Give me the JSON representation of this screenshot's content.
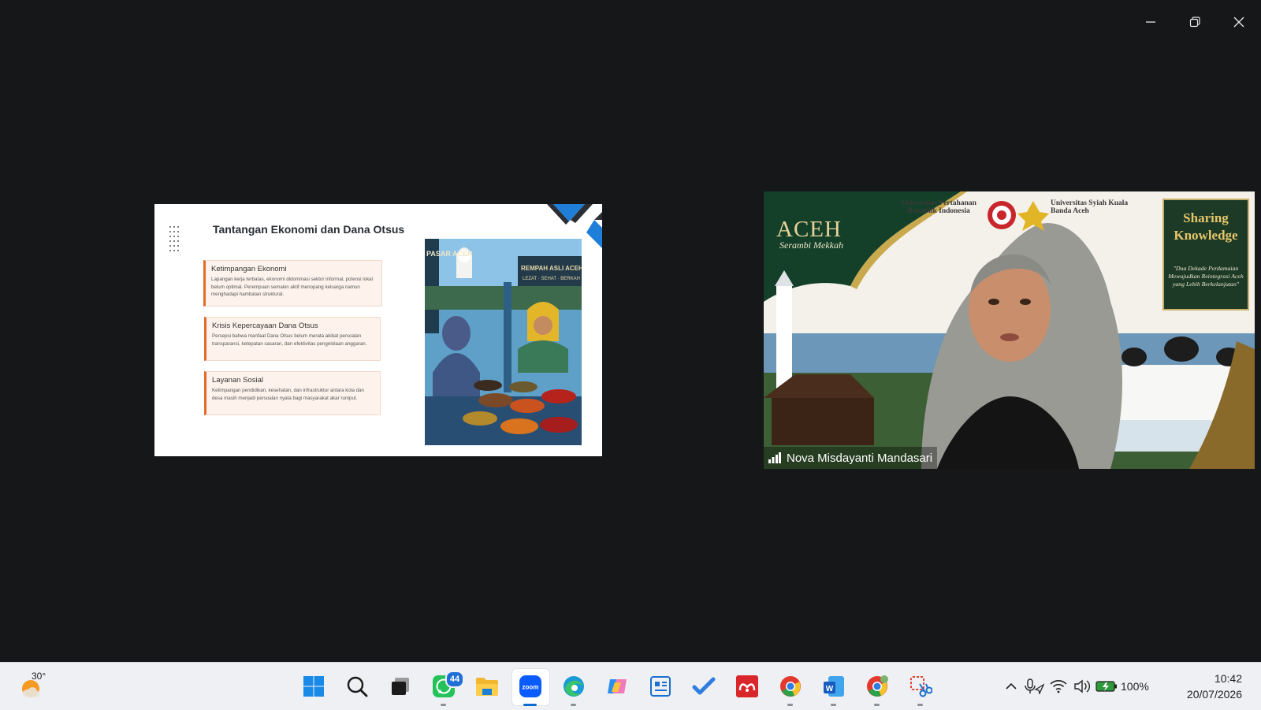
{
  "window": {
    "controls": [
      "minimize-icon",
      "restore-icon",
      "close-icon"
    ]
  },
  "slide": {
    "title": "Tantangan Ekonomi dan Dana Otsus",
    "cards": [
      {
        "title": "Ketimpangan Ekonomi",
        "text": "Lapangan kerja terbatas, ekonomi didominasi sektor informal, potensi lokal belum optimal. Perempuan semakin aktif menopang keluarga namun menghadapi hambatan struktural."
      },
      {
        "title": "Krisis Kepercayaan Dana Otsus",
        "text": "Persepsi bahwa manfaat Dana Otsus belum merata akibat persoalan transparansi, ketepatan sasaran, dan efektivitas pengelolaan anggaran."
      },
      {
        "title": "Layanan Sosial",
        "text": "Ketimpangan pendidikan, kesehatan, dan infrastruktur antara kota dan desa masih menjadi persoalan nyata bagi masyarakat akar rumput."
      }
    ],
    "image_signs": {
      "main": "REMPAH ASLI ACEH",
      "sub": "LEZAT · SEHAT · BERKAH",
      "left": "PASAR ACEH"
    }
  },
  "video": {
    "participant_name": "Nova Misdayanti Mandasari",
    "background": {
      "region": "ACEH",
      "region_sub": "Serambi Mekkah",
      "uni_left": "Universitas Pertahanan Republik Indonesia",
      "uni_right": "Universitas Syiah Kuala Banda Aceh",
      "panel_title_1": "Sharing",
      "panel_title_2": "Knowledge",
      "panel_subtitle": "\"Dua Dekade Perdamaian Mewujudkan Reintegrasi Aceh yang Lebih Berkelanjutan\""
    }
  },
  "taskbar": {
    "weather_temp": "30°",
    "apps": [
      {
        "name": "start",
        "icon": "windows-start-icon"
      },
      {
        "name": "search",
        "icon": "search-icon"
      },
      {
        "name": "task-view",
        "icon": "task-view-icon"
      },
      {
        "name": "whatsapp",
        "icon": "whatsapp-icon",
        "badge": "44"
      },
      {
        "name": "file-explorer",
        "icon": "folder-icon"
      },
      {
        "name": "zoom",
        "icon": "zoom-icon",
        "label": "zoom"
      },
      {
        "name": "edge",
        "icon": "edge-icon"
      },
      {
        "name": "copilot",
        "icon": "copilot-icon"
      },
      {
        "name": "news",
        "icon": "news-icon"
      },
      {
        "name": "todo",
        "icon": "checkmark-icon"
      },
      {
        "name": "mendeley",
        "icon": "mendeley-icon"
      },
      {
        "name": "chrome",
        "icon": "chrome-icon"
      },
      {
        "name": "word",
        "icon": "word-icon",
        "label": "W"
      },
      {
        "name": "chrome-profile",
        "icon": "chrome-icon"
      },
      {
        "name": "snipping-tool",
        "icon": "scissors-icon"
      }
    ],
    "battery": "100%",
    "time": "10:42",
    "date": "20/07/2026",
    "colors": {
      "accent": "#0b6bd2",
      "taskbar_bg": "#eef0f3"
    }
  }
}
